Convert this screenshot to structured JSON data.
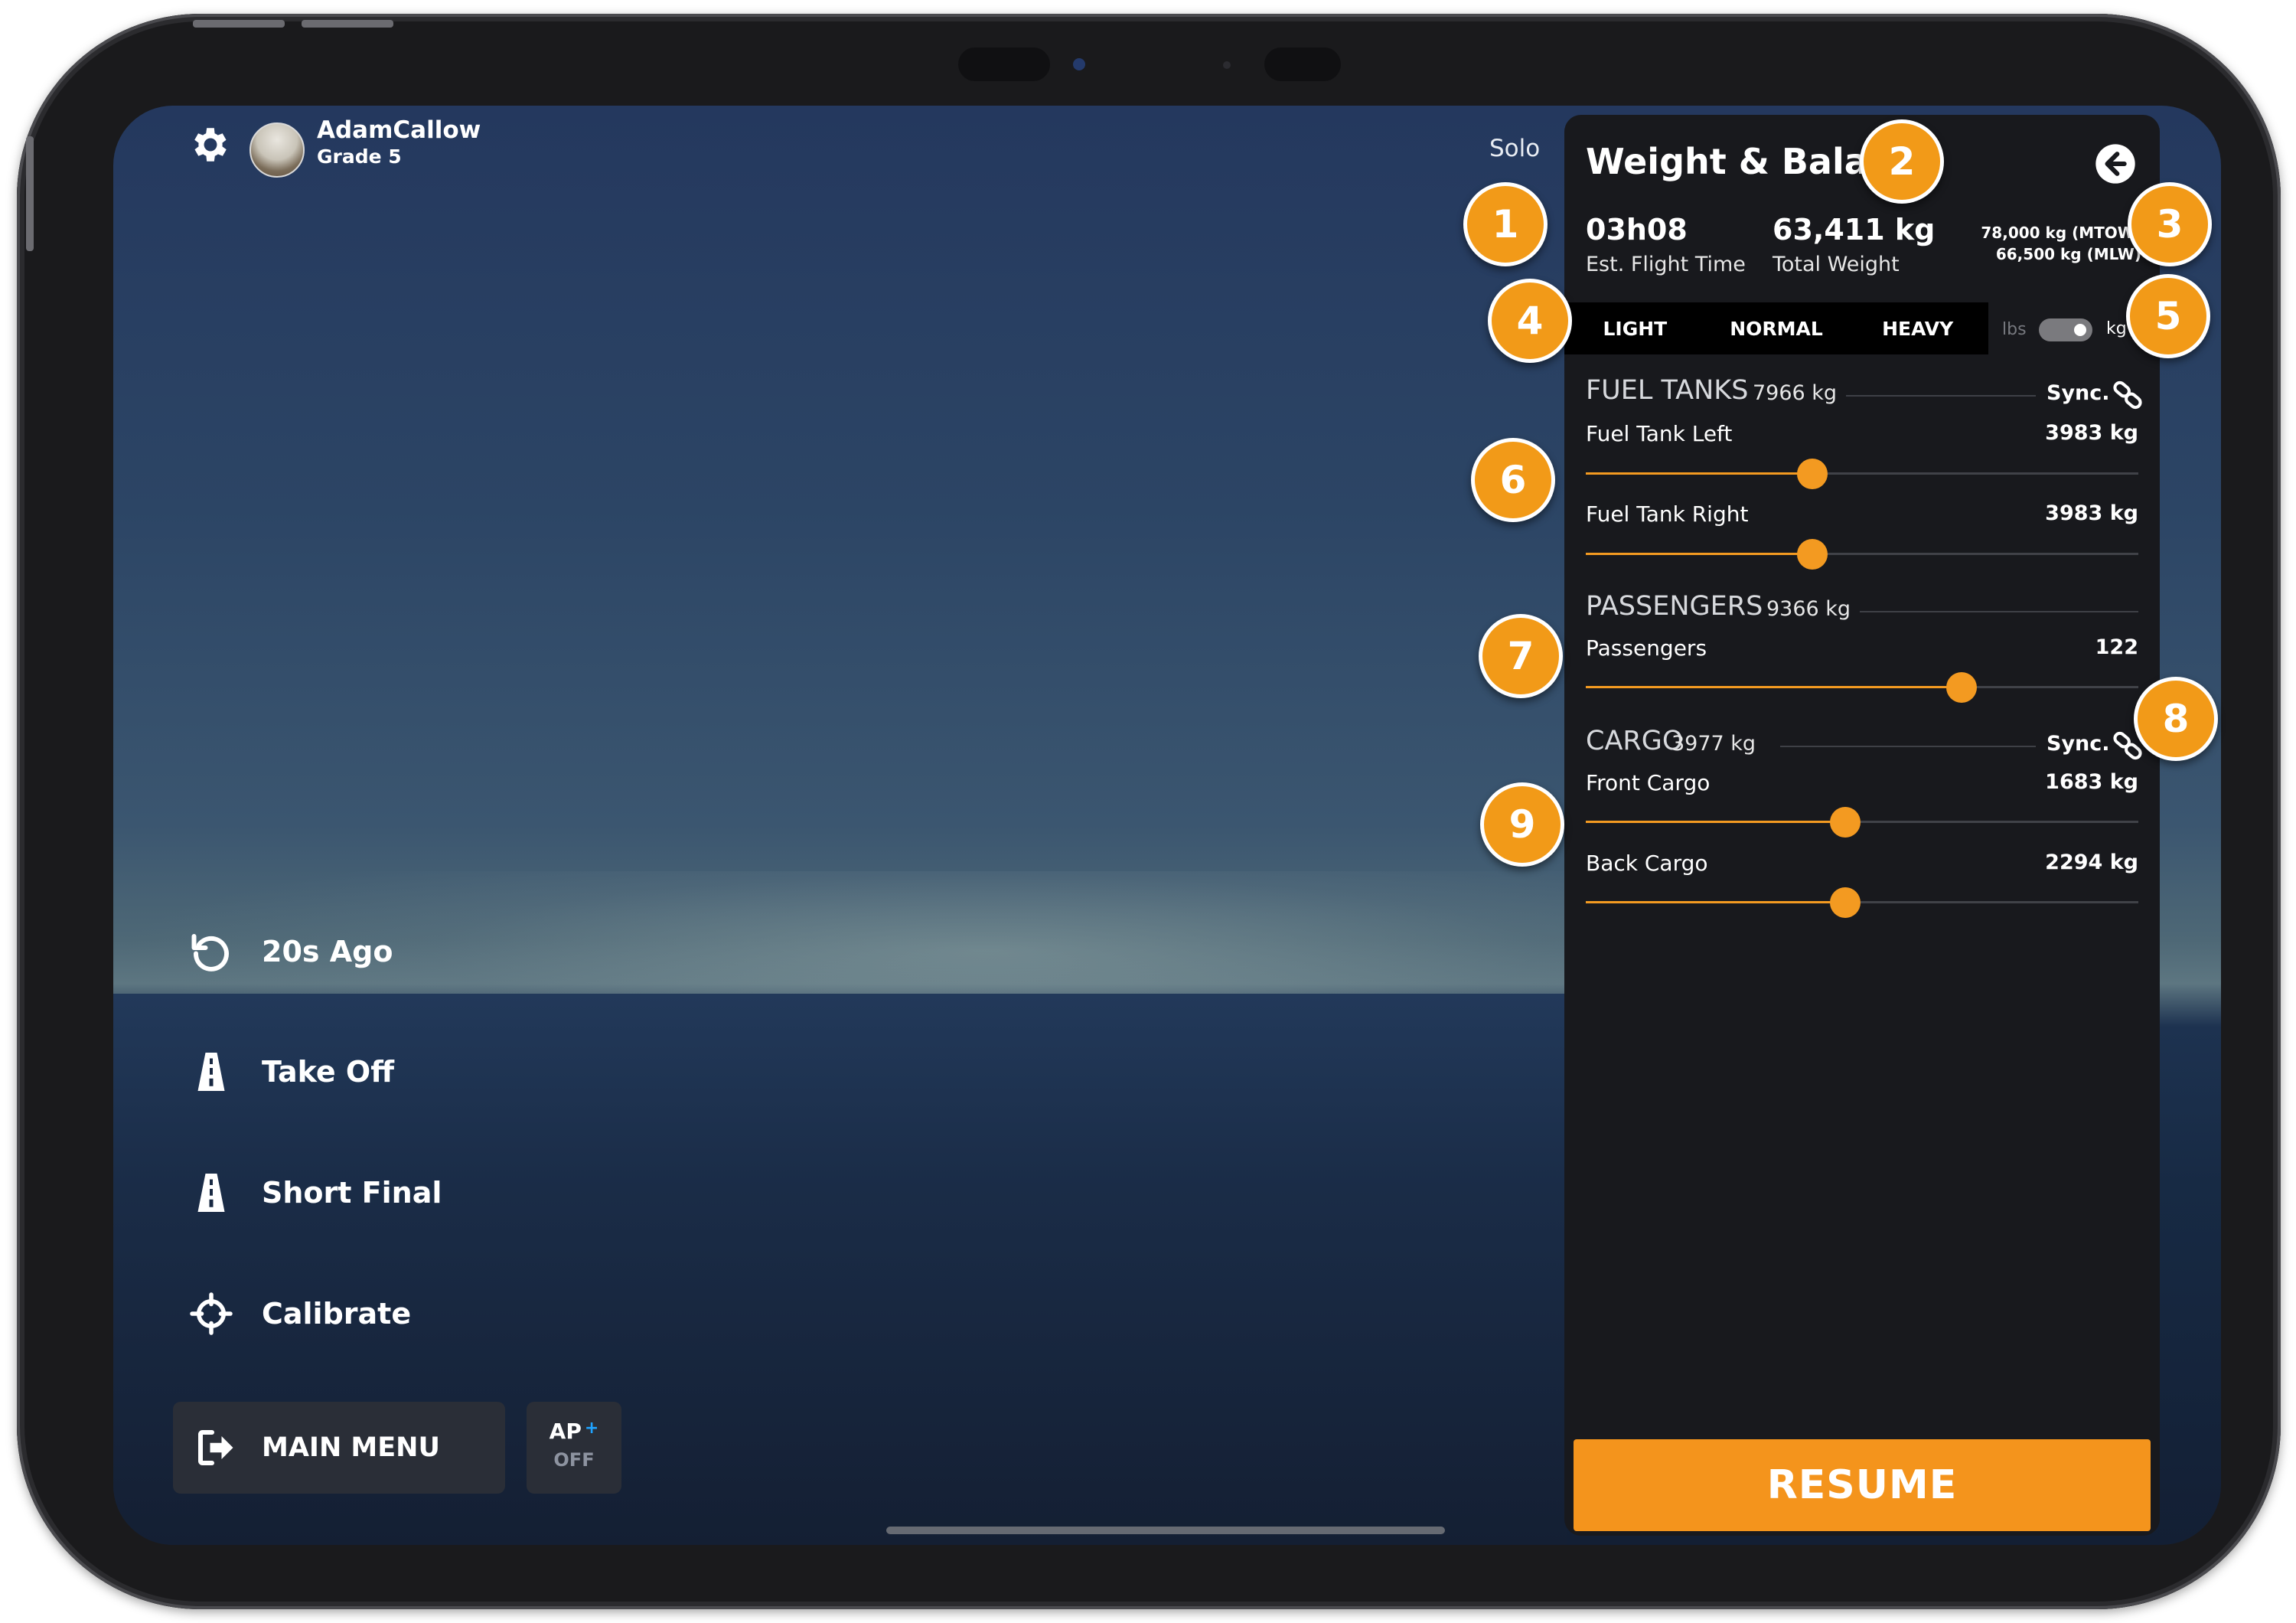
{
  "hud": {
    "user_name": "AdamCallow",
    "user_grade": "Grade 5",
    "mode": "Solo",
    "menu": [
      {
        "label": "20s Ago",
        "icon": "replay-icon"
      },
      {
        "label": "Take Off",
        "icon": "runway-icon"
      },
      {
        "label": "Short Final",
        "icon": "runway-icon"
      },
      {
        "label": "Calibrate",
        "icon": "crosshair-icon"
      }
    ],
    "main_menu_label": "MAIN MENU",
    "ap_label": "AP",
    "ap_plus": "+",
    "ap_status": "OFF"
  },
  "panel": {
    "title": "Weight & Balance",
    "flight_time": "03h08",
    "flight_time_label": "Est. Flight Time",
    "total_weight": "63,411 kg",
    "total_weight_label": "Total Weight",
    "mtow": "78,000 kg (MTOW)",
    "mlw": "66,500 kg (MLW)",
    "presets": [
      "LIGHT",
      "NORMAL",
      "HEAVY"
    ],
    "unit_lbs": "lbs",
    "unit_kg": "kg",
    "unit_selected": "kg",
    "sync_label": "Sync.",
    "fuel": {
      "title": "FUEL TANKS",
      "total": "7966 kg",
      "rows": [
        {
          "label": "Fuel Tank Left",
          "value": "3983 kg",
          "level": 0.41
        },
        {
          "label": "Fuel Tank Right",
          "value": "3983 kg",
          "level": 0.41
        }
      ]
    },
    "passengers": {
      "title": "PASSENGERS",
      "total": "9366 kg",
      "rows": [
        {
          "label": "Passengers",
          "value": "122",
          "level": 0.68
        }
      ]
    },
    "cargo": {
      "title": "CARGO",
      "total": "3977 kg",
      "rows": [
        {
          "label": "Front Cargo",
          "value": "1683 kg",
          "level": 0.47
        },
        {
          "label": "Back Cargo",
          "value": "2294 kg",
          "level": 0.47
        }
      ]
    },
    "resume_label": "RESUME"
  },
  "callouts": [
    "1",
    "2",
    "3",
    "4",
    "5",
    "6",
    "7",
    "8",
    "9"
  ],
  "colors": {
    "accent": "#f39a21",
    "panel_bg": "#18191d",
    "ap_plus": "#1fa3ff"
  }
}
